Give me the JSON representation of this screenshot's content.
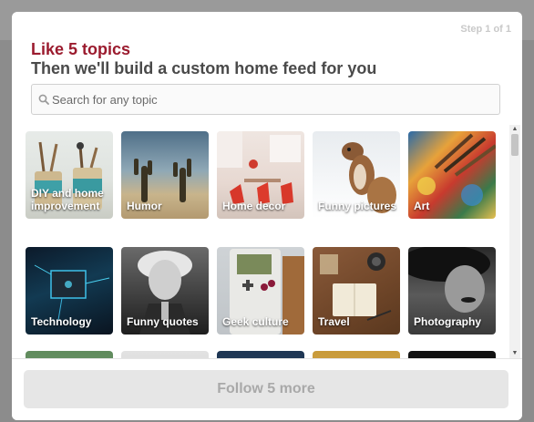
{
  "modal": {
    "step": "Step 1 of 1",
    "title": "Like 5 topics",
    "subtitle": "Then we'll build a custom home feed for you"
  },
  "search": {
    "placeholder": "Search for any topic",
    "icon": "search-icon"
  },
  "topics": [
    {
      "name": "diy-and-home-improvement",
      "label": "DIY and home improvement"
    },
    {
      "name": "humor",
      "label": "Humor"
    },
    {
      "name": "home-decor",
      "label": "Home decor"
    },
    {
      "name": "funny-pictures",
      "label": "Funny pictures"
    },
    {
      "name": "art",
      "label": "Art"
    },
    {
      "name": "technology",
      "label": "Technology"
    },
    {
      "name": "funny-quotes",
      "label": "Funny quotes"
    },
    {
      "name": "geek-culture",
      "label": "Geek culture"
    },
    {
      "name": "travel",
      "label": "Travel"
    },
    {
      "name": "photography",
      "label": "Photography"
    }
  ],
  "footer": {
    "follow_label": "Follow 5 more"
  }
}
